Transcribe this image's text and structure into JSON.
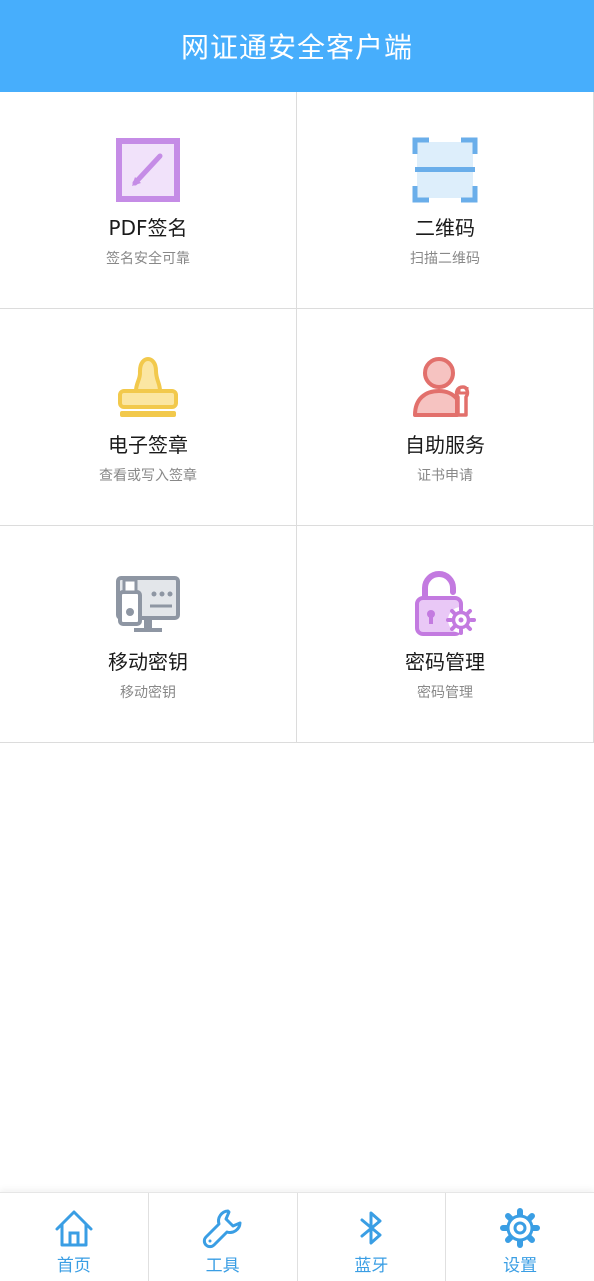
{
  "header": {
    "title": "网证通安全客户端"
  },
  "grid": [
    {
      "title": "PDF签名",
      "subtitle": "签名安全可靠",
      "icon": "pdf-sign-icon",
      "color": "#c58ce6"
    },
    {
      "title": "二维码",
      "subtitle": "扫描二维码",
      "icon": "qr-scan-icon",
      "color": "#6aaeea"
    },
    {
      "title": "电子签章",
      "subtitle": "查看或写入签章",
      "icon": "stamp-icon",
      "color": "#f2c94c"
    },
    {
      "title": "自助服务",
      "subtitle": "证书申请",
      "icon": "user-service-icon",
      "color": "#e2706c"
    },
    {
      "title": "移动密钥",
      "subtitle": "移动密钥",
      "icon": "usb-key-icon",
      "color": "#8e96a3"
    },
    {
      "title": "密码管理",
      "subtitle": "密码管理",
      "icon": "lock-settings-icon",
      "color": "#c37ae0"
    }
  ],
  "tabbar": {
    "accent": "#3a9ee4",
    "items": [
      {
        "label": "首页",
        "icon": "home-icon"
      },
      {
        "label": "工具",
        "icon": "wrench-icon"
      },
      {
        "label": "蓝牙",
        "icon": "bluetooth-icon"
      },
      {
        "label": "设置",
        "icon": "gear-icon"
      }
    ]
  }
}
